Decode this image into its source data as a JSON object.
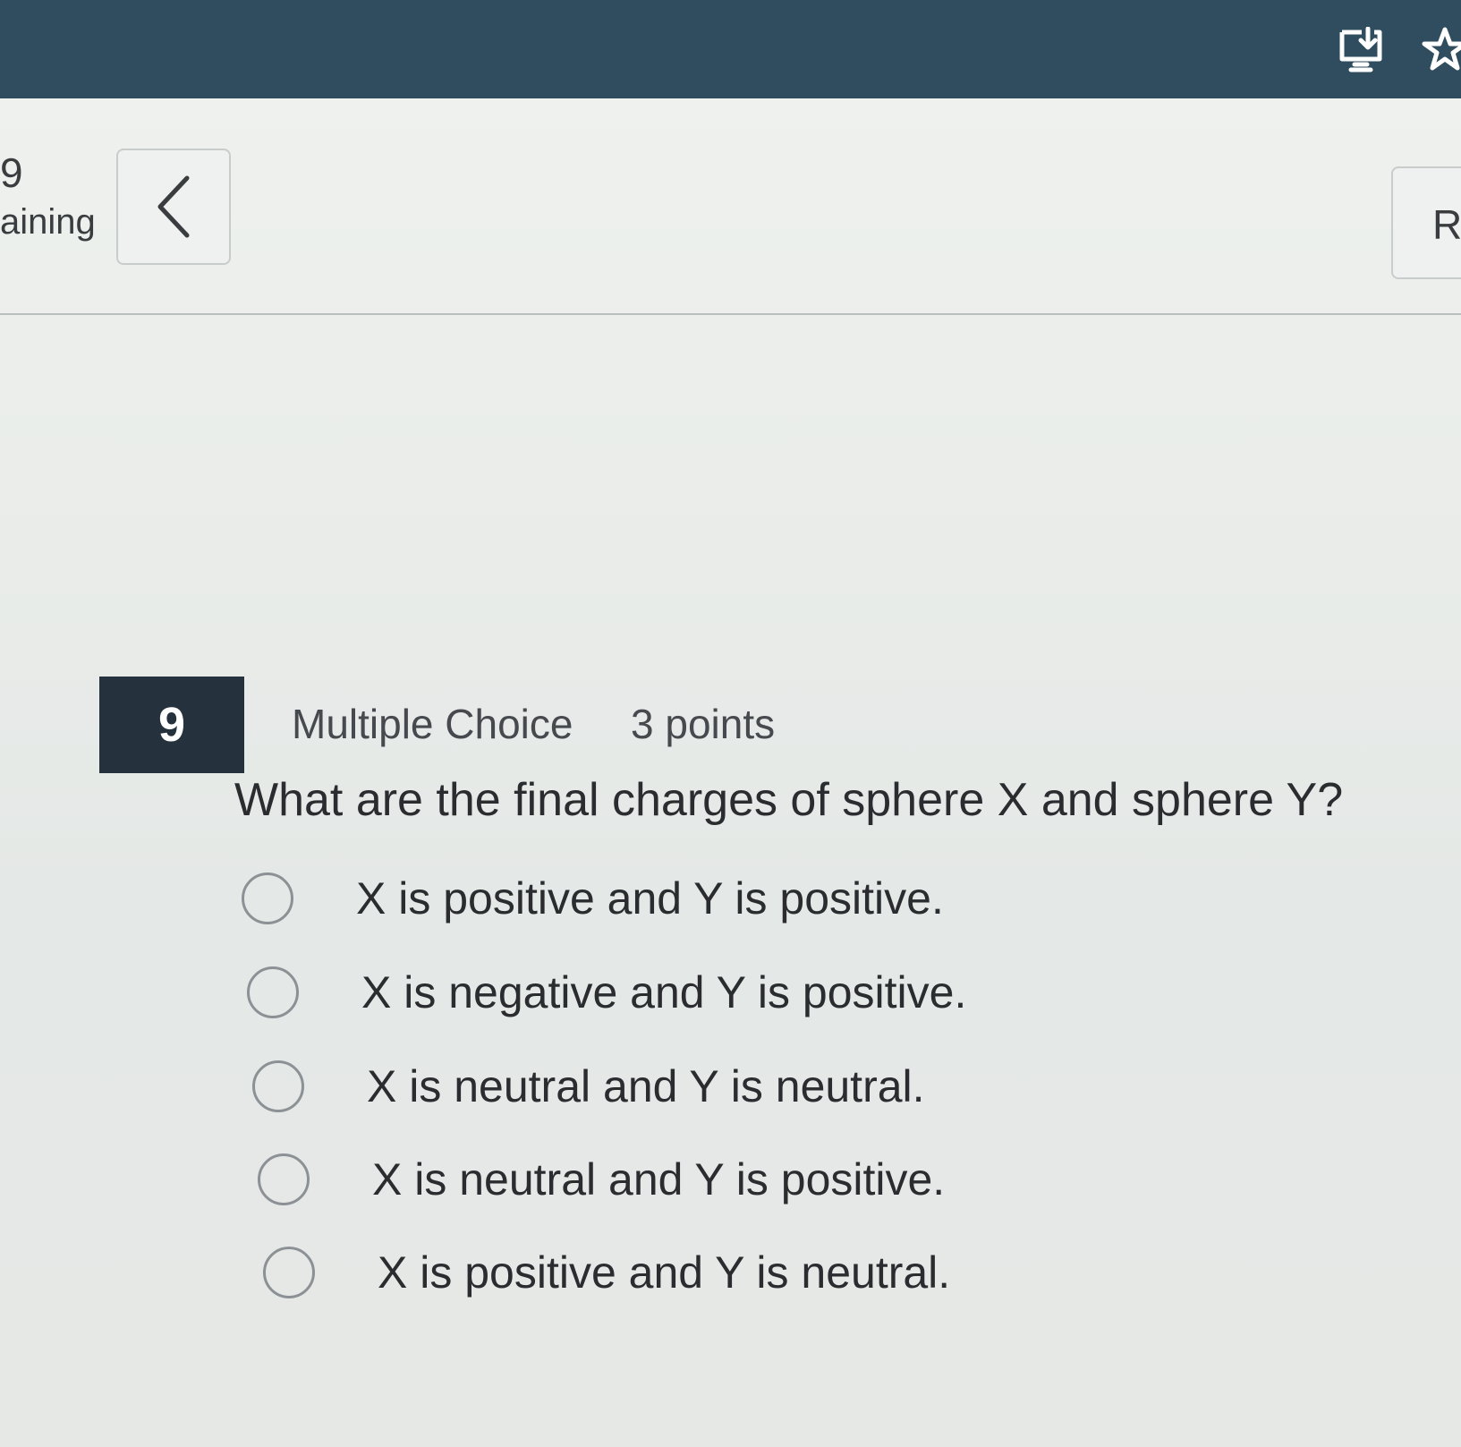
{
  "header": {
    "remaining_count": "9",
    "remaining_label": "aining",
    "back_glyph": "‹",
    "right_button_label": "R",
    "icons": [
      "download-screen-icon",
      "star-icon"
    ]
  },
  "question": {
    "number": "9",
    "type": "Multiple Choice",
    "points": "3 points",
    "text": "What are the final charges of sphere X and sphere Y?",
    "options": [
      {
        "label": "X is positive and Y is positive.",
        "selected": false
      },
      {
        "label": "X is negative and Y is positive.",
        "selected": false
      },
      {
        "label": "X is neutral and Y is neutral.",
        "selected": false
      },
      {
        "label": "X is neutral and Y is positive.",
        "selected": false
      },
      {
        "label": "X is positive and Y is neutral.",
        "selected": false
      }
    ]
  },
  "colors": {
    "topbar": "#2f4d5e",
    "question_number_bg": "#25313c",
    "text": "#2a2c2f"
  }
}
